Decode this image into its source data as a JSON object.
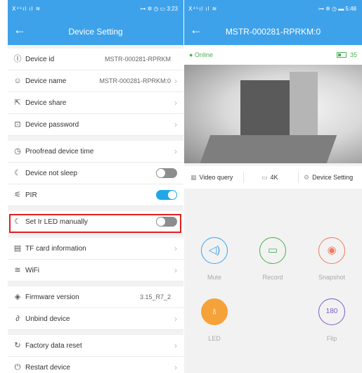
{
  "left": {
    "status_left": "ⵝ⁴⁶ıl ıl ≋",
    "status_right": "⊶ ✲ ◷ ▭ 3:23",
    "title": "Device Setting",
    "rows": [
      {
        "label": "Device id",
        "value": "MSTR-000281-RPRKM"
      },
      {
        "label": "Device name",
        "value": "MSTR-000281-RPRKM:0"
      },
      {
        "label": "Device share"
      },
      {
        "label": "Device password"
      },
      {
        "label": "Proofread device time"
      },
      {
        "label": "Device not sleep"
      },
      {
        "label": "PIR"
      },
      {
        "label": "Set Ir LED manually"
      },
      {
        "label": "TF card information"
      },
      {
        "label": "WiFi"
      },
      {
        "label": "Firmware version",
        "value": "3.15_R7_2"
      },
      {
        "label": "Unbind device"
      },
      {
        "label": "Factory data reset"
      },
      {
        "label": "Restart device"
      }
    ]
  },
  "right": {
    "status_left": "ⵝ⁴⁶ıl ıl ≋",
    "status_right": "⊶ ✲ ◷ ▬ 5:48",
    "title": "MSTR-000281-RPRKM:0",
    "online": "● Online",
    "battery": "35",
    "tools": {
      "video_query": "Video query",
      "resolution": "4K",
      "settings": "Device Setting"
    },
    "actions": {
      "mute": "Mute",
      "record": "Record",
      "snapshot": "Snapshot",
      "led": "LED",
      "flip": "Flip"
    }
  },
  "colors": {
    "accent": "#3ea2ea",
    "toggle_on": "#1fa8e8",
    "highlight": "#e02020",
    "led": "#f6a23b"
  }
}
